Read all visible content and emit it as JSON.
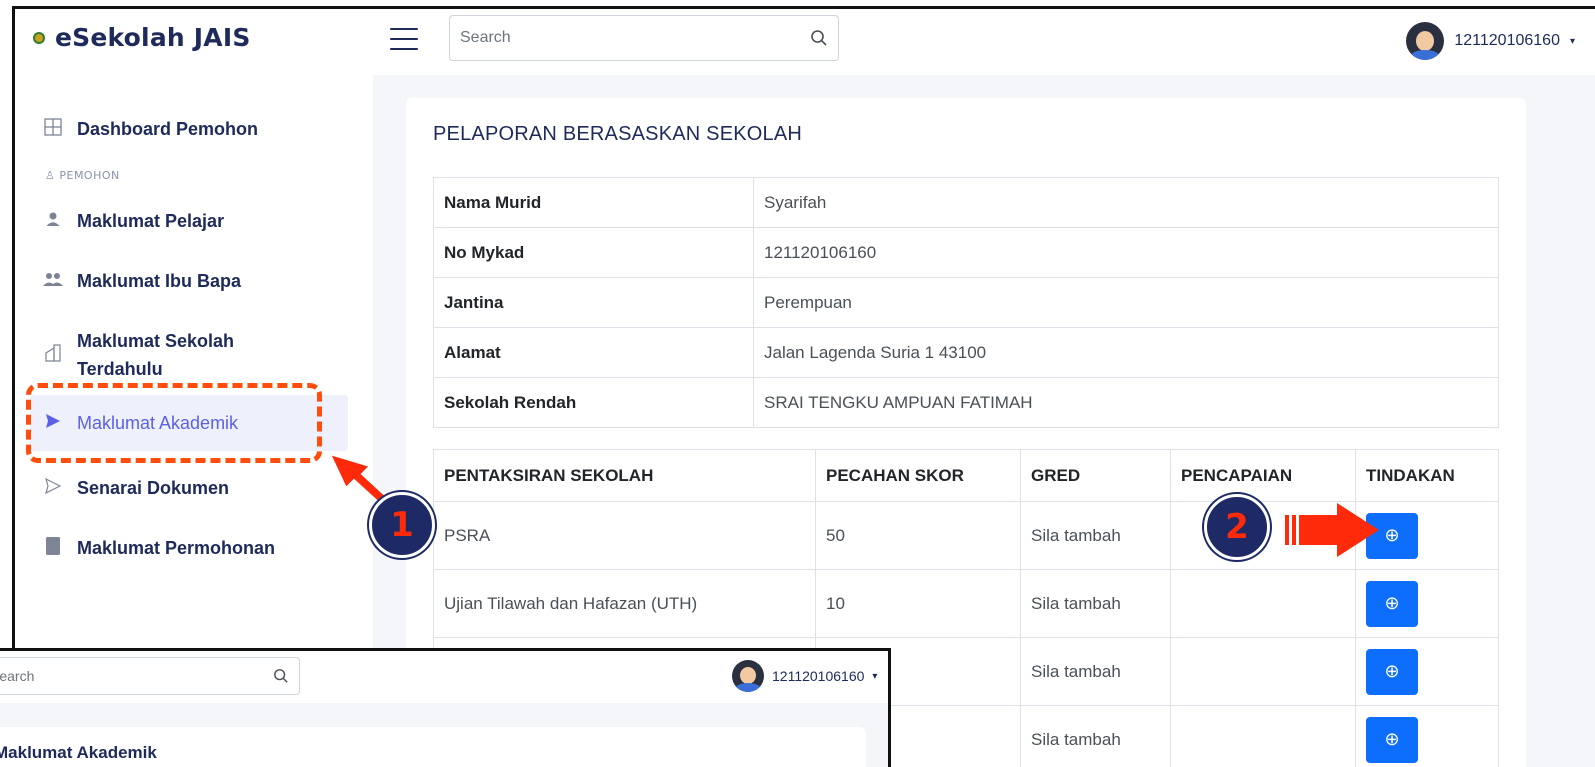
{
  "app": {
    "brand": "eSekolah JAIS"
  },
  "search": {
    "placeholder": "Search"
  },
  "user": {
    "id": "121120106160"
  },
  "sidebar": {
    "section_label": "PEMOHON",
    "items": [
      {
        "label": "Dashboard Pemohon",
        "icon": "grid-icon"
      },
      {
        "label": "Maklumat Pelajar",
        "icon": "user-icon"
      },
      {
        "label": "Maklumat Ibu Bapa",
        "icon": "users-icon"
      },
      {
        "label": "Maklumat Sekolah Terdahulu",
        "icon": "building-icon"
      },
      {
        "label": "Maklumat Akademik",
        "icon": "send-icon",
        "active": true
      },
      {
        "label": "Senarai Dokumen",
        "icon": "send-icon"
      },
      {
        "label": "Maklumat Permohonan",
        "icon": "book-icon"
      }
    ]
  },
  "main": {
    "title": "PELAPORAN BERASASKAN SEKOLAH",
    "info": [
      {
        "label": "Nama Murid",
        "value": "Syarifah"
      },
      {
        "label": "No Mykad",
        "value": "121120106160"
      },
      {
        "label": "Jantina",
        "value": "Perempuan"
      },
      {
        "label": "Alamat",
        "value": "Jalan Lagenda Suria 1 43100"
      },
      {
        "label": "Sekolah Rendah",
        "value": "SRAI TENGKU AMPUAN FATIMAH"
      }
    ],
    "scores_headers": [
      "PENTAKSIRAN SEKOLAH",
      "PECAHAN SKOR",
      "GRED",
      "PENCAPAIAN",
      "TINDAKAN"
    ],
    "scores_rows": [
      {
        "assessment": "PSRA",
        "score": "50",
        "grade": "Sila tambah",
        "achievement": ""
      },
      {
        "assessment": "Ujian Tilawah dan Hafazan (UTH)",
        "score": "10",
        "grade": "Sila tambah",
        "achievement": ""
      },
      {
        "assessment": "",
        "score": "",
        "grade": "Sila tambah",
        "achievement": ""
      },
      {
        "assessment": "",
        "score": "",
        "grade": "Sila tambah",
        "achievement": ""
      }
    ],
    "add_button_glyph": "⊕"
  },
  "annotations": {
    "step1": "1",
    "step2": "2"
  },
  "inset": {
    "search_placeholder": "Search",
    "user_id": "121120106160",
    "title": "Maklumat Akademik"
  },
  "colors": {
    "accent": "#0d6efd",
    "danger": "#dc3545",
    "annotation": "#ff4d0d",
    "badge": "#1d2a66"
  }
}
